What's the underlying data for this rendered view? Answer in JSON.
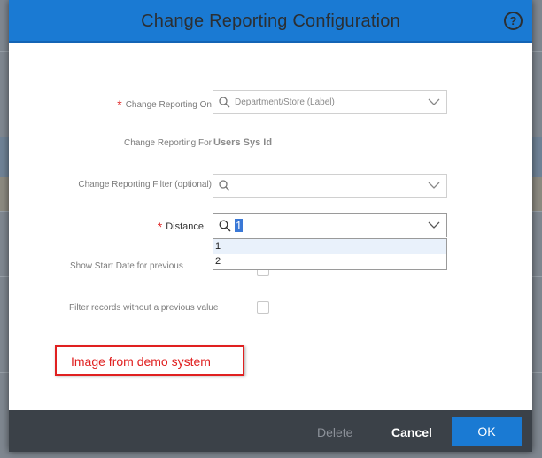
{
  "dialog": {
    "title": "Change Reporting Configuration",
    "help_icon": "question-circle-icon",
    "accent_color": "#1a7ad3"
  },
  "form": {
    "change_reporting_on": {
      "label": "Change Reporting On",
      "value": "Department/Store (Label)",
      "required": true
    },
    "change_reporting_for": {
      "label": "Change Reporting For",
      "value": "Users Sys Id"
    },
    "change_reporting_filter": {
      "label": "Change Reporting Filter (optional)",
      "value": ""
    },
    "distance": {
      "label": "Distance",
      "value": "1",
      "required": true,
      "options": [
        "1",
        "2"
      ]
    },
    "show_start_date": {
      "label": "Show Start Date for previous"
    },
    "filter_records": {
      "label": "Filter records without a previous value"
    }
  },
  "annotation": {
    "text": "Image from demo system",
    "color": "#e02020"
  },
  "footer": {
    "delete_label": "Delete",
    "cancel_label": "Cancel",
    "ok_label": "OK"
  }
}
